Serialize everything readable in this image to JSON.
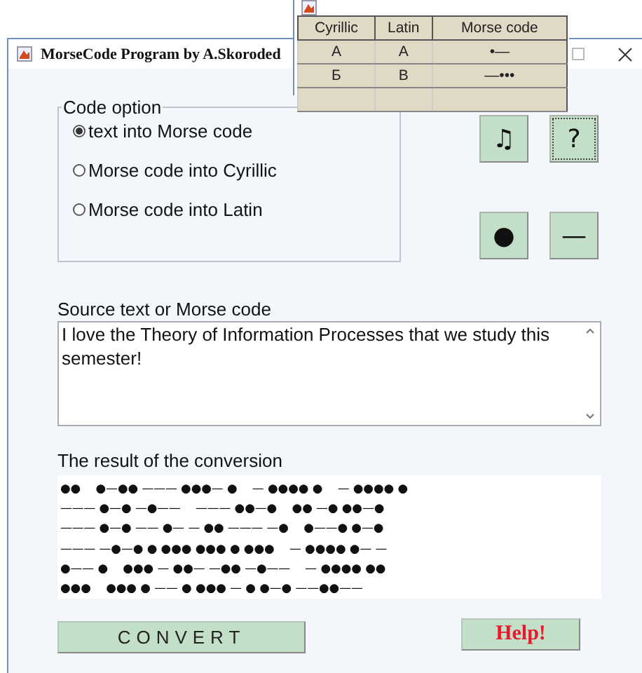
{
  "window": {
    "title": "MorseCode Program by A.Skoroded"
  },
  "reference_table": {
    "columns": [
      "Cyrillic",
      "Latin",
      "Morse code"
    ],
    "rows": [
      [
        "А",
        "A",
        "•—"
      ],
      [
        "Б",
        "B",
        "—•••"
      ]
    ]
  },
  "code_option": {
    "title": "Code option",
    "options": [
      {
        "label": "text into Morse code",
        "selected": true
      },
      {
        "label": "Morse code into Cyrillic",
        "selected": false
      },
      {
        "label": "Morse code into Latin",
        "selected": false
      }
    ]
  },
  "tool_buttons": [
    {
      "label": "♫",
      "focused": false
    },
    {
      "label": "?",
      "focused": true
    },
    {
      "label": "●",
      "focused": false
    },
    {
      "label": "—",
      "focused": false
    }
  ],
  "source": {
    "label": "Source text or Morse code",
    "value": "I love the Theory of Information Processes that we study this semester!"
  },
  "result": {
    "label": "The result of the conversion",
    "lines": [
      "●●    ●—●● ——— ●●●— ●    — ●●●● ●    — ●●●● ●",
      "——— ●—● —●——    ——— ●●—●    ●● —● ●●—●",
      "——— ●—● —— ●— — ●● ——— —●    ●——● ●—●",
      "——— —●—● ● ●●● ●●● ● ●●●    — ●●●● ●— —",
      "●—— ●    ●●● — ●●— —●● —●——    — ●●●● ●●",
      "●●●    ●●● ● —— ● ●●● — ● ●—● ——●●——"
    ]
  },
  "convert_button": "CONVERT",
  "help_button": "Help!"
}
